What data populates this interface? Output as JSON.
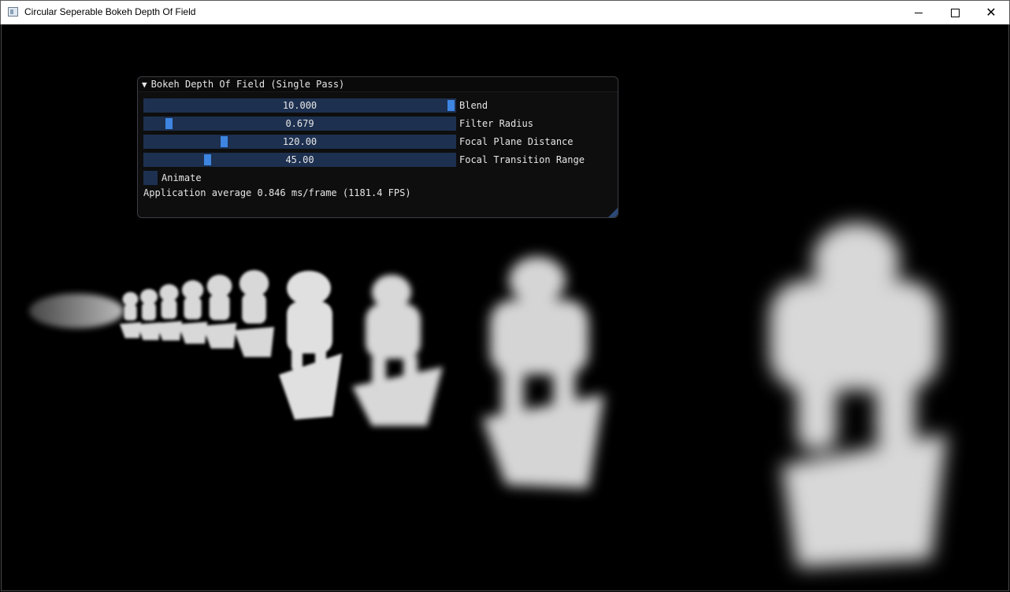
{
  "window": {
    "title": "Circular Seperable Bokeh Depth Of Field",
    "icon": "app-window-icon"
  },
  "controls": {
    "minimize_icon": "minimize-icon",
    "maximize_icon": "maximize-icon",
    "close_icon": "close-icon",
    "close_glyph": "✕"
  },
  "panel": {
    "arrow": "▼",
    "title": "Bokeh Depth Of Field (Single Pass)",
    "sliders": [
      {
        "value": "10.000",
        "label": "Blend",
        "fraction": 1.0
      },
      {
        "value": "0.679",
        "label": "Filter Radius",
        "fraction": 0.068
      },
      {
        "value": "120.00",
        "label": "Focal Plane Distance",
        "fraction": 0.25
      },
      {
        "value": "45.00",
        "label": "Focal Transition Range",
        "fraction": 0.195
      }
    ],
    "checkbox": {
      "label": "Animate",
      "checked": false
    },
    "fps_text": "Application average 0.846 ms/frame (1181.4 FPS)"
  },
  "colors": {
    "slider_bg": "#1d3050",
    "grab": "#3d85e0",
    "panel_bg": "#0f0f0f"
  }
}
